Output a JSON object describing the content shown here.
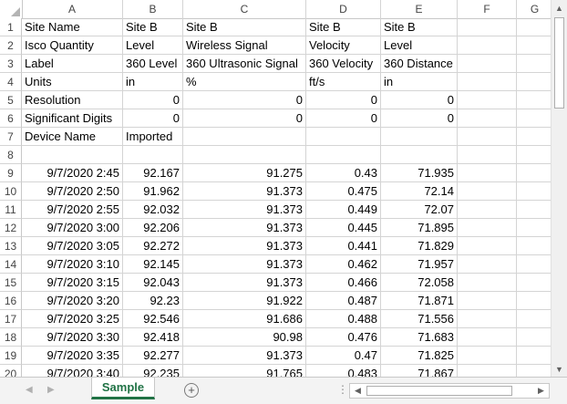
{
  "columns": [
    "A",
    "B",
    "C",
    "D",
    "E",
    "F",
    "G"
  ],
  "header_rows": [
    {
      "num": "1",
      "a": "Site Name",
      "b": "Site B",
      "c": "Site B",
      "d": "Site B",
      "e": "Site B"
    },
    {
      "num": "2",
      "a": "Isco Quantity",
      "b": "Level",
      "c": "Wireless Signal",
      "d": "Velocity",
      "e": "Level"
    },
    {
      "num": "3",
      "a": "Label",
      "b": "360 Level",
      "c": "360 Ultrasonic Signal",
      "d": "360 Velocity",
      "e": "360 Distance"
    },
    {
      "num": "4",
      "a": "Units",
      "b": "in",
      "c": "%",
      "d": "ft/s",
      "e": "in"
    },
    {
      "num": "5",
      "a": "Resolution",
      "b": "0",
      "c": "0",
      "d": "0",
      "e": "0"
    },
    {
      "num": "6",
      "a": "Significant Digits",
      "b": "0",
      "c": "0",
      "d": "0",
      "e": "0"
    },
    {
      "num": "7",
      "a": "Device Name",
      "b": "Imported",
      "c": "",
      "d": "",
      "e": ""
    },
    {
      "num": "8",
      "a": "",
      "b": "",
      "c": "",
      "d": "",
      "e": ""
    }
  ],
  "data_rows": [
    {
      "num": "9",
      "a": "9/7/2020 2:45",
      "b": "92.167",
      "c": "91.275",
      "d": "0.43",
      "e": "71.935"
    },
    {
      "num": "10",
      "a": "9/7/2020 2:50",
      "b": "91.962",
      "c": "91.373",
      "d": "0.475",
      "e": "72.14"
    },
    {
      "num": "11",
      "a": "9/7/2020 2:55",
      "b": "92.032",
      "c": "91.373",
      "d": "0.449",
      "e": "72.07"
    },
    {
      "num": "12",
      "a": "9/7/2020 3:00",
      "b": "92.206",
      "c": "91.373",
      "d": "0.445",
      "e": "71.895"
    },
    {
      "num": "13",
      "a": "9/7/2020 3:05",
      "b": "92.272",
      "c": "91.373",
      "d": "0.441",
      "e": "71.829"
    },
    {
      "num": "14",
      "a": "9/7/2020 3:10",
      "b": "92.145",
      "c": "91.373",
      "d": "0.462",
      "e": "71.957"
    },
    {
      "num": "15",
      "a": "9/7/2020 3:15",
      "b": "92.043",
      "c": "91.373",
      "d": "0.466",
      "e": "72.058"
    },
    {
      "num": "16",
      "a": "9/7/2020 3:20",
      "b": "92.23",
      "c": "91.922",
      "d": "0.487",
      "e": "71.871"
    },
    {
      "num": "17",
      "a": "9/7/2020 3:25",
      "b": "92.546",
      "c": "91.686",
      "d": "0.488",
      "e": "71.556"
    },
    {
      "num": "18",
      "a": "9/7/2020 3:30",
      "b": "92.418",
      "c": "90.98",
      "d": "0.476",
      "e": "71.683"
    },
    {
      "num": "19",
      "a": "9/7/2020 3:35",
      "b": "92.277",
      "c": "91.373",
      "d": "0.47",
      "e": "71.825"
    },
    {
      "num": "20",
      "a": "9/7/2020 3:40",
      "b": "92.235",
      "c": "91.765",
      "d": "0.483",
      "e": "71.867"
    }
  ],
  "sheet_tab": "Sample",
  "add_sheet_symbol": "+",
  "tab_dots": "⋮",
  "icons": {
    "scroll_up": "▲",
    "scroll_down": "▼",
    "scroll_left": "◀",
    "scroll_right": "▶",
    "nav_prev": "◀",
    "nav_next": "▶"
  },
  "colors": {
    "accent": "#217346",
    "gridline": "#d4d4d4",
    "header_text": "#444444"
  }
}
